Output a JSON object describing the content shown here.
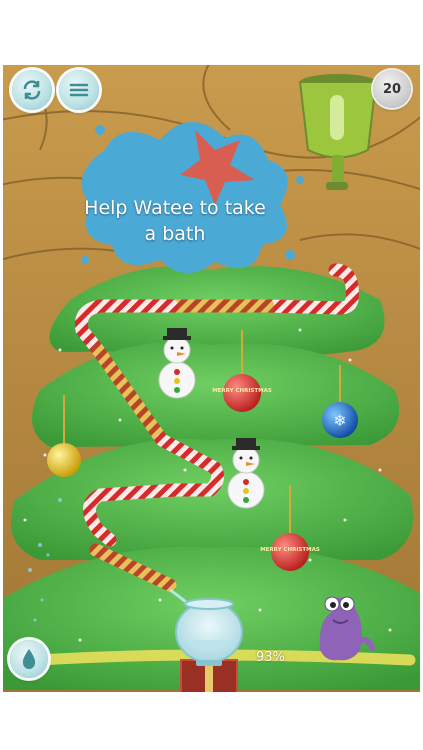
{
  "hud": {
    "restart_icon": "restart-arrows-icon",
    "menu_icon": "menu-lines-icon",
    "moves_left": "20",
    "water_button_icon": "water-drop-icon"
  },
  "tutorial": {
    "message": "Help Watee to take a bath"
  },
  "ornaments": {
    "ball_text": "MERRY CHRISTMAS"
  },
  "progress": {
    "fill_percent_label": "93%",
    "fill_fraction": 0.93
  },
  "colors": {
    "tree": "#4caf45",
    "splash": "#4ba9d6",
    "candy_red": "#d52b2b",
    "wall": "#b8893f",
    "progress_bar": "#e8e05a"
  }
}
